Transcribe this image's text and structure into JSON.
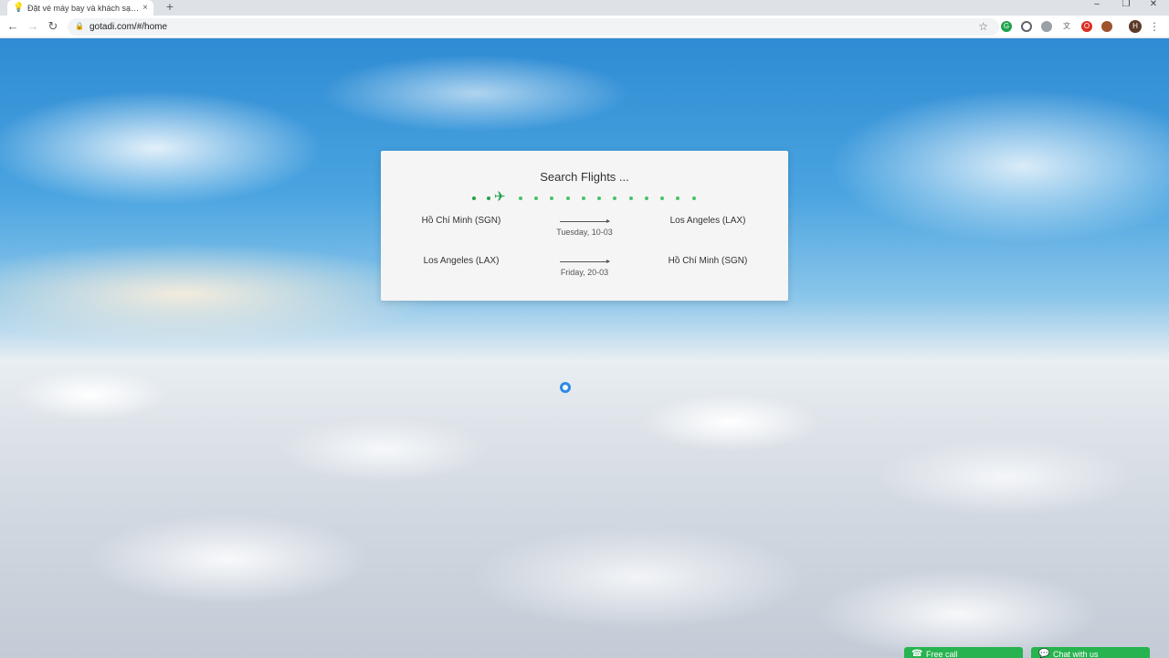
{
  "browser": {
    "tab_title": "Đặt vé máy bay và khách sạn trên",
    "tab_close": "×",
    "new_tab": "+",
    "url": "gotadi.com/#/home",
    "minimize": "–",
    "restore": "❐",
    "close": "✕",
    "profile_initial": "H"
  },
  "search": {
    "title": "Search Flights ...",
    "legs": [
      {
        "from": "Hồ Chí Minh (SGN)",
        "to": "Los Angeles (LAX)",
        "date": "Tuesday, 10-03"
      },
      {
        "from": "Los Angeles (LAX)",
        "to": "Hồ Chí Minh (SGN)",
        "date": "Friday, 20-03"
      }
    ]
  },
  "footer": {
    "free_call": "Free call",
    "chat": "Chat with us"
  },
  "colors": {
    "accent_green": "#1fa24a",
    "dot_green": "#45c26c"
  }
}
